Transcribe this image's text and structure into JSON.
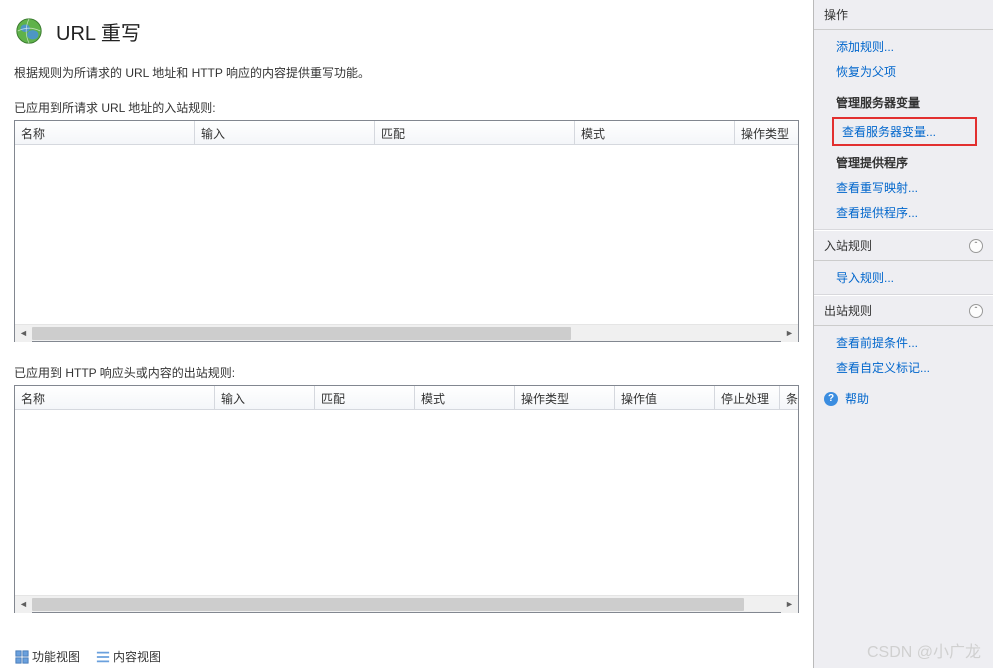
{
  "header": {
    "title": "URL 重写"
  },
  "description": "根据规则为所请求的 URL 地址和 HTTP 响应的内容提供重写功能。",
  "inbound": {
    "label": "已应用到所请求 URL 地址的入站规则:",
    "columns": [
      "名称",
      "输入",
      "匹配",
      "模式",
      "操作类型"
    ]
  },
  "outbound": {
    "label": "已应用到 HTTP 响应头或内容的出站规则:",
    "columns": [
      "名称",
      "输入",
      "匹配",
      "模式",
      "操作类型",
      "操作值",
      "停止处理",
      "条"
    ]
  },
  "actions": {
    "header": "操作",
    "add_rule": "添加规则...",
    "revert_parent": "恢复为父项",
    "manage_server_vars_label": "管理服务器变量",
    "view_server_vars": "查看服务器变量...",
    "manage_providers_label": "管理提供程序",
    "view_rewrite_map": "查看重写映射...",
    "view_providers": "查看提供程序...",
    "inbound_header": "入站规则",
    "import_rules": "导入规则...",
    "outbound_header": "出站规则",
    "view_preconditions": "查看前提条件...",
    "view_custom_tags": "查看自定义标记...",
    "help": "帮助"
  },
  "bottom_tabs": {
    "features_view": "功能视图",
    "content_view": "内容视图"
  },
  "watermark": "CSDN @小广龙"
}
